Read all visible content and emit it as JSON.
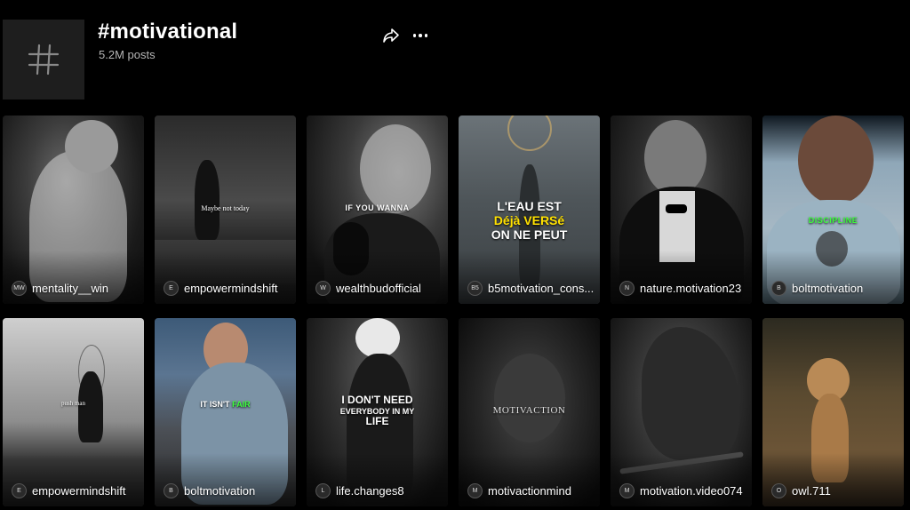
{
  "header": {
    "title": "#motivational",
    "posts": "5.2M posts"
  },
  "icons": {
    "hashtag": "hashtag-icon",
    "share": "share-arrow-icon",
    "more": "more-horizontal-icon"
  },
  "colors": {
    "background": "#000000",
    "card_text": "#ffffff",
    "accent_green": "#3cff3c",
    "accent_yellow": "#ffe100"
  },
  "videos": [
    {
      "author": "mentality__win",
      "overlay": "",
      "avatar_text": "MW"
    },
    {
      "author": "empowermindshift",
      "overlay": "Maybe not today",
      "avatar_text": "E"
    },
    {
      "author": "wealthbudofficial",
      "overlay": "IF YOU WANNA",
      "avatar_text": "W"
    },
    {
      "author": "b5motivation_cons...",
      "overlay_line1": "L'EAU EST",
      "overlay_line2a": "Déjà",
      "overlay_line2b": "VERSé",
      "overlay_line3": "ON NE PEUT",
      "avatar_text": "B5"
    },
    {
      "author": "nature.motivation23",
      "overlay": "",
      "avatar_text": "N"
    },
    {
      "author": "boltmotivation",
      "overlay": "DISCIPLINE",
      "avatar_text": "B"
    },
    {
      "author": "empowermindshift",
      "overlay": "push man",
      "avatar_text": "E"
    },
    {
      "author": "boltmotivation",
      "overlay_a": "IT ISN'T",
      "overlay_b": "FAIR",
      "avatar_text": "B"
    },
    {
      "author": "life.changes8",
      "overlay_line1": "I DON'T NEED",
      "overlay_line2": "EVERYBODY IN MY",
      "overlay_line3": "LIFE",
      "avatar_text": "L"
    },
    {
      "author": "motivactionmind",
      "overlay": "MOTIVACTION",
      "avatar_text": "M"
    },
    {
      "author": "motivation.video074",
      "overlay": "",
      "avatar_text": "M"
    },
    {
      "author": "owl.711",
      "overlay": "",
      "avatar_text": "O"
    }
  ]
}
